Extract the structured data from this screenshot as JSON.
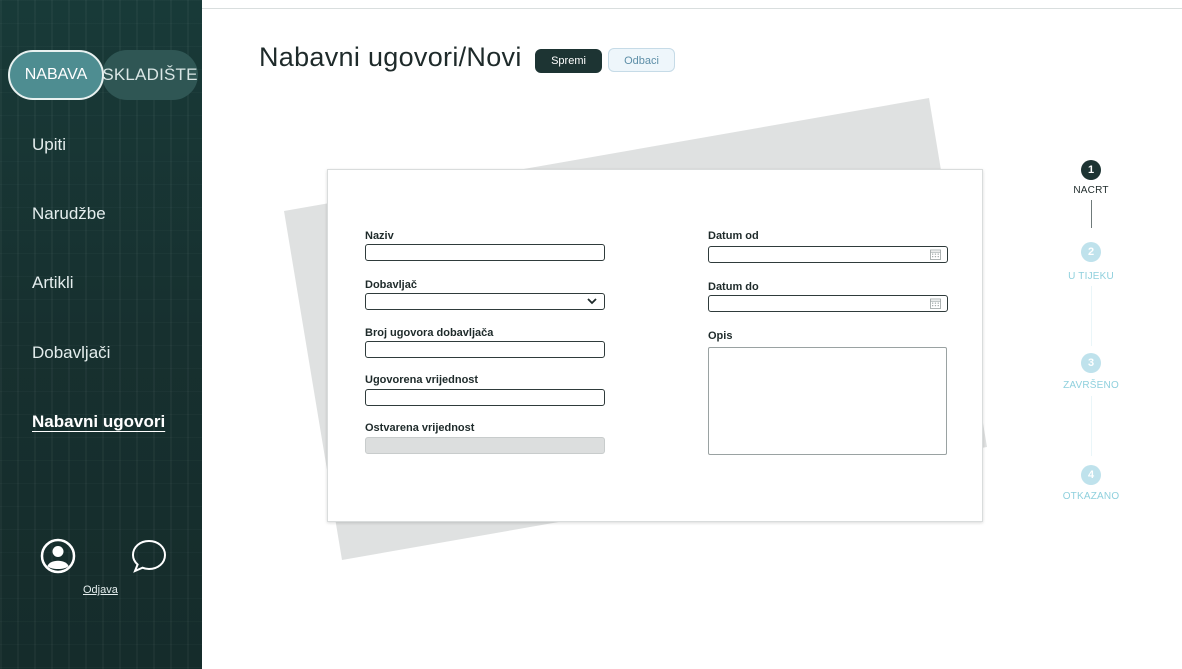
{
  "sidebar": {
    "toggle": {
      "active": "NABAVA",
      "inactive": "SKLADIŠTE"
    },
    "items": [
      {
        "label": "Upiti"
      },
      {
        "label": "Narudžbe"
      },
      {
        "label": "Artikli"
      },
      {
        "label": "Dobavljači"
      },
      {
        "label": "Nabavni ugovori",
        "active": true
      }
    ],
    "logout": "Odjava",
    "icons": [
      "user-avatar-icon",
      "chat-bubble-icon"
    ]
  },
  "header": {
    "title": "Nabavni ugovori/Novi",
    "save_label": "Spremi",
    "cancel_label": "Odbaci"
  },
  "form": {
    "naziv_label": "Naziv",
    "naziv_value": "",
    "dobavljac_label": "Dobavljač",
    "dobavljac_value": "",
    "broj_label": "Broj ugovora dobavljača",
    "broj_value": "",
    "ugovorena_label": "Ugovorena vrijednost",
    "ugovorena_value": "",
    "ostvarena_label": "Ostvarena vrijednost",
    "ostvarena_value": "",
    "datum_od_label": "Datum od",
    "datum_od_value": "",
    "datum_do_label": "Datum do",
    "datum_do_value": "",
    "opis_label": "Opis",
    "opis_value": ""
  },
  "status_steps": [
    {
      "num": "1",
      "label": "NACRT",
      "active": true
    },
    {
      "num": "2",
      "label": "U TIJEKU",
      "active": false
    },
    {
      "num": "3",
      "label": "ZAVRŠENO",
      "active": false
    },
    {
      "num": "4",
      "label": "OTKAZANO",
      "active": false
    }
  ],
  "colors": {
    "sidebar_bg": "#17302f",
    "accent": "#4e8d91",
    "step_active": "#1d3433",
    "step_inactive": "#bfe2ec",
    "paper_back": "#dfe1e1"
  }
}
